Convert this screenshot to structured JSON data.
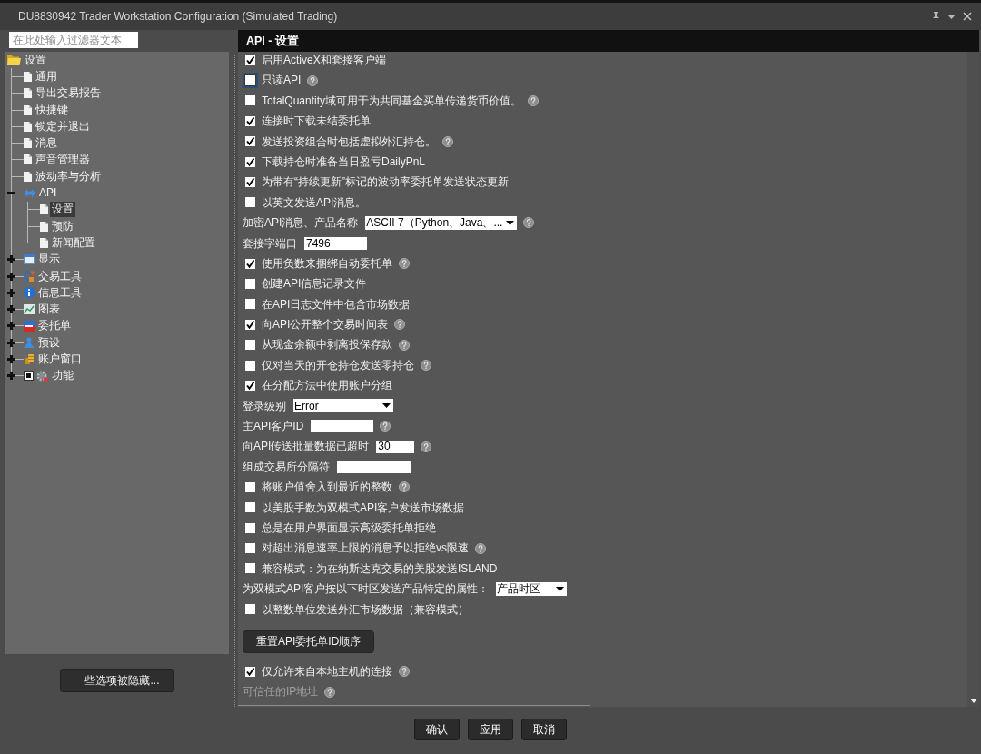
{
  "window": {
    "title": "DU8830942 Trader Workstation Configuration (Simulated Trading)"
  },
  "filter": {
    "placeholder": "在此处输入过滤器文本"
  },
  "tree": [
    {
      "label": "设置",
      "kind": "folder",
      "selected": false,
      "children": [
        {
          "label": "通用",
          "kind": "page",
          "selected": false
        },
        {
          "label": "导出交易报告",
          "kind": "page",
          "selected": false
        },
        {
          "label": "快捷键",
          "kind": "page",
          "selected": false
        },
        {
          "label": "锁定并退出",
          "kind": "page",
          "selected": false
        },
        {
          "label": "消息",
          "kind": "page",
          "selected": false
        },
        {
          "label": "声音管理器",
          "kind": "page",
          "selected": false
        },
        {
          "label": "波动率与分析",
          "kind": "page",
          "selected": false
        },
        {
          "label": "API",
          "kind": "api",
          "selected": false,
          "expanded": true,
          "children": [
            {
              "label": "设置",
              "kind": "page",
              "selected": true
            },
            {
              "label": "预防",
              "kind": "page",
              "selected": false
            },
            {
              "label": "新闻配置",
              "kind": "page",
              "selected": false
            }
          ]
        },
        {
          "label": "显示",
          "kind": "display",
          "selected": false,
          "expanded": false
        },
        {
          "label": "交易工具",
          "kind": "tools",
          "selected": false,
          "expanded": false
        },
        {
          "label": "信息工具",
          "kind": "info",
          "selected": false,
          "expanded": false
        },
        {
          "label": "图表",
          "kind": "chart",
          "selected": false,
          "expanded": false
        },
        {
          "label": "委托单",
          "kind": "orders",
          "selected": false,
          "expanded": false
        },
        {
          "label": "预设",
          "kind": "presets",
          "selected": false,
          "expanded": false
        },
        {
          "label": "账户窗口",
          "kind": "accounts",
          "selected": false,
          "expanded": false
        },
        {
          "label": "功能",
          "kind": "features",
          "selected": false,
          "expanded": false,
          "checked": true
        }
      ]
    }
  ],
  "hidden_options_button": {
    "label": "一些选项被隐藏..."
  },
  "panel": {
    "title": "API - 设置",
    "settings": [
      {
        "kind": "checkbox",
        "label": "启用ActiveX和套接客户端",
        "checked": true,
        "focused": false,
        "help": false
      },
      {
        "kind": "checkbox",
        "label": "只读API",
        "checked": false,
        "focused": true,
        "help": true
      },
      {
        "kind": "checkbox",
        "label": "TotalQuantity域可用于为共同基金买单传递货币价值。",
        "checked": false,
        "focused": false,
        "help": true
      },
      {
        "kind": "checkbox",
        "label": "连接时下载未结委托单",
        "checked": true,
        "focused": false,
        "help": false
      },
      {
        "kind": "checkbox",
        "label": "发送投资组合时包括虚拟外汇持仓。",
        "checked": true,
        "focused": false,
        "help": true
      },
      {
        "kind": "checkbox",
        "label": "下载持仓时准备当日盈亏DailyPnL",
        "checked": true,
        "focused": false,
        "help": false
      },
      {
        "kind": "checkbox",
        "label": "为带有“持续更新”标记的波动率委托单发送状态更新",
        "checked": true,
        "focused": false,
        "help": false
      },
      {
        "kind": "checkbox",
        "label": "以英文发送API消息。",
        "checked": false,
        "focused": false,
        "help": false
      },
      {
        "kind": "select",
        "label": "加密API消息、产品名称",
        "value": "ASCII 7（Python、Java、...",
        "help": true
      },
      {
        "kind": "text",
        "label": "套接字端口",
        "value": "7496",
        "help": false
      },
      {
        "kind": "checkbox",
        "label": "使用负数来捆绑自动委托单",
        "checked": true,
        "focused": false,
        "help": true
      },
      {
        "kind": "checkbox",
        "label": "创建API信息记录文件",
        "checked": false,
        "focused": false,
        "help": false
      },
      {
        "kind": "checkbox",
        "label": "在API日志文件中包含市场数据",
        "checked": false,
        "focused": false,
        "help": false
      },
      {
        "kind": "checkbox",
        "label": "向API公开整个交易时间表",
        "checked": true,
        "focused": false,
        "help": true
      },
      {
        "kind": "checkbox",
        "label": "从现金余额中剥离投保存款",
        "checked": false,
        "focused": false,
        "help": true
      },
      {
        "kind": "checkbox",
        "label": "仅对当天的开仓持仓发送零持仓",
        "checked": false,
        "focused": false,
        "help": true
      },
      {
        "kind": "checkbox",
        "label": "在分配方法中使用账户分组",
        "checked": true,
        "focused": false,
        "help": false
      },
      {
        "kind": "select",
        "label": "登录级别",
        "value": "Error",
        "help": false
      },
      {
        "kind": "text",
        "label": "主API客户ID",
        "help": true
      },
      {
        "kind": "text",
        "label": "向API传送批量数据已超时",
        "value": "30",
        "help": true
      },
      {
        "kind": "text",
        "label": "组成交易所分隔符",
        "help": false
      },
      {
        "kind": "checkbox",
        "label": "将账户值舍入到最近的整数",
        "checked": false,
        "focused": false,
        "help": true
      },
      {
        "kind": "checkbox",
        "label": "以美股手数为双模式API客户发送市场数据",
        "checked": false,
        "focused": false,
        "help": false
      },
      {
        "kind": "checkbox",
        "label": "总是在用户界面显示高级委托单拒绝",
        "checked": false,
        "focused": false,
        "help": false
      },
      {
        "kind": "checkbox",
        "label": "对超出消息速率上限的消息予以拒绝vs限速",
        "checked": false,
        "focused": false,
        "help": true
      },
      {
        "kind": "checkbox",
        "label": "兼容模式：为在纳斯达克交易的美股发送ISLAND",
        "checked": false,
        "focused": false,
        "help": false
      },
      {
        "kind": "select",
        "label": "为双模式API客户按以下时区发送产品特定的属性：",
        "value": "产品时区",
        "help": false
      },
      {
        "kind": "checkbox",
        "label": "以整数单位发送外汇市场数据（兼容模式）",
        "checked": false,
        "focused": false,
        "help": false
      },
      {
        "kind": "button",
        "label": "重置API委托单ID顺序",
        "help": false
      },
      {
        "kind": "checkbox",
        "label": "仅允许来自本地主机的连接",
        "checked": true,
        "focused": false,
        "help": true
      },
      {
        "kind": "label",
        "label": "可信任的IP地址",
        "disabled": true,
        "help": true
      }
    ]
  },
  "dialog_buttons": [
    {
      "label": "确认"
    },
    {
      "label": "应用"
    },
    {
      "label": "取消"
    }
  ]
}
